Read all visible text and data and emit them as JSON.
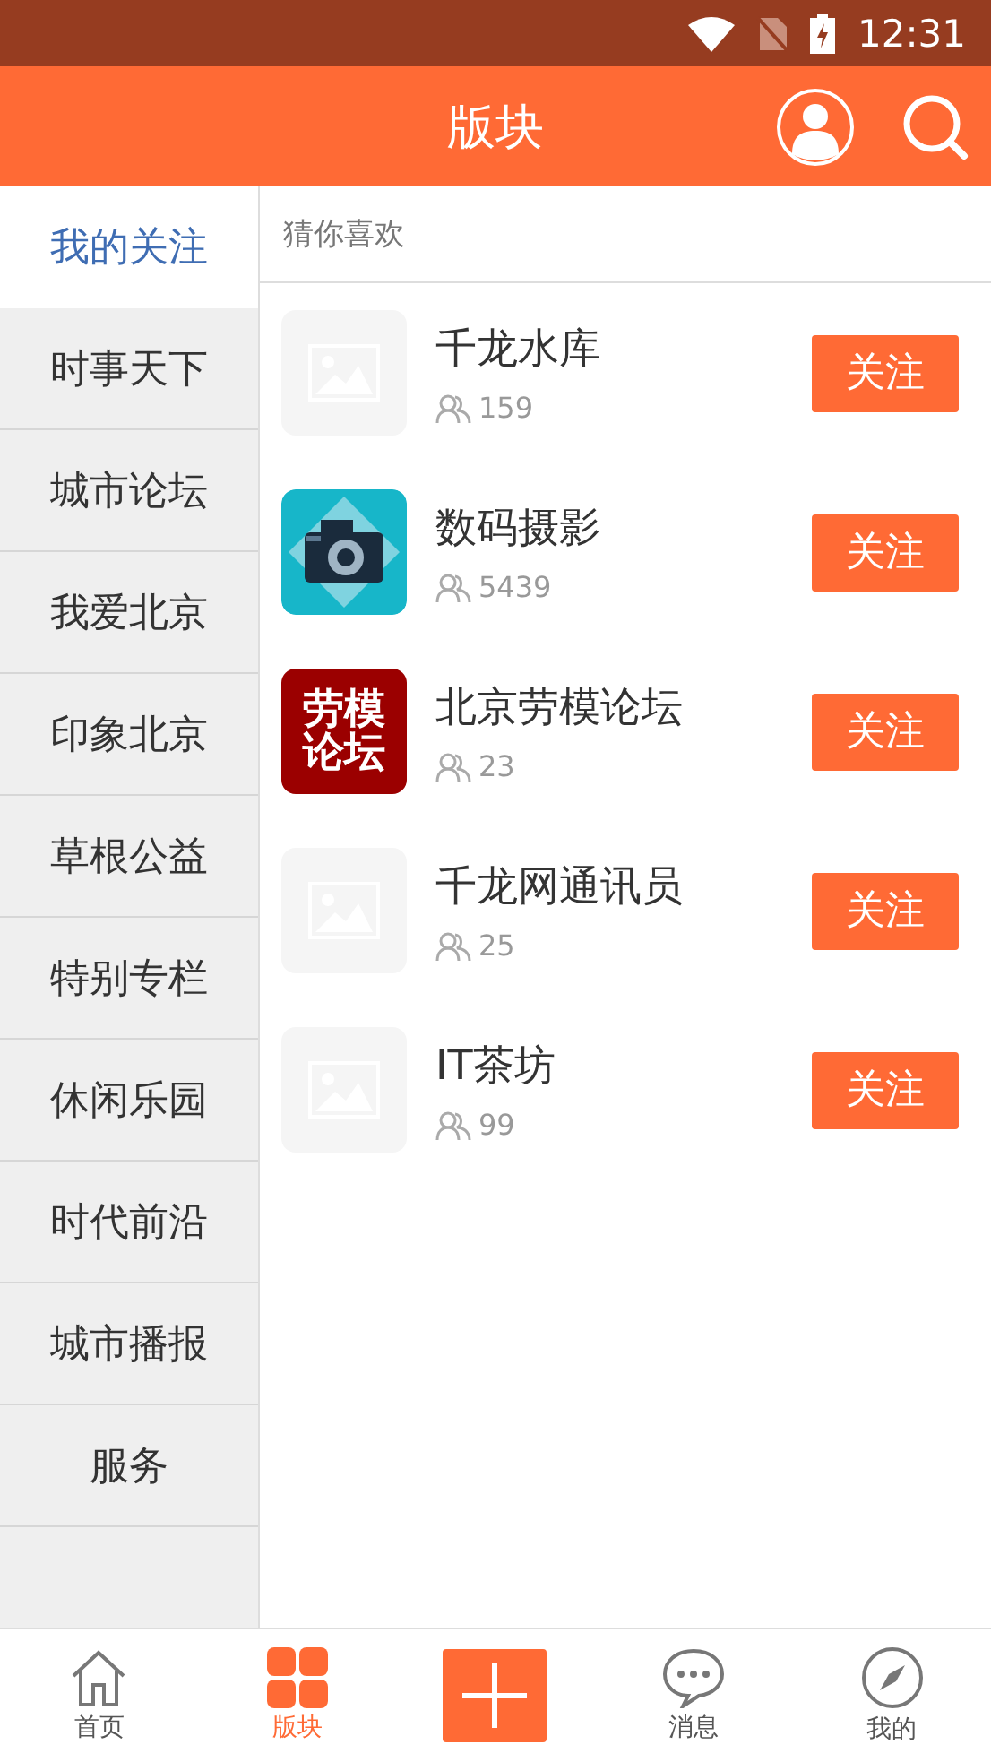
{
  "status_bar": {
    "time": "12:31"
  },
  "header": {
    "title": "版块"
  },
  "sidebar": {
    "items": [
      {
        "label": "我的关注",
        "selected": true
      },
      {
        "label": "时事天下",
        "selected": false
      },
      {
        "label": "城市论坛",
        "selected": false
      },
      {
        "label": "我爱北京",
        "selected": false
      },
      {
        "label": "印象北京",
        "selected": false
      },
      {
        "label": "草根公益",
        "selected": false
      },
      {
        "label": "特别专栏",
        "selected": false
      },
      {
        "label": "休闲乐园",
        "selected": false
      },
      {
        "label": "时代前沿",
        "selected": false
      },
      {
        "label": "城市播报",
        "selected": false
      },
      {
        "label": "服务",
        "selected": false
      }
    ]
  },
  "section_title": "猜你喜欢",
  "forums": [
    {
      "name": "千龙水库",
      "members": "159",
      "icon": {
        "kind": "placeholder"
      },
      "button": "关注"
    },
    {
      "name": "数码摄影",
      "members": "5439",
      "button": "关注"
    },
    {
      "name": "北京劳模论坛",
      "members": "23",
      "icon": {
        "kind": "logo",
        "text": "劳模论坛"
      },
      "button": "关注"
    },
    {
      "name": "千龙网通讯员",
      "members": "25",
      "icon": {
        "kind": "placeholder"
      },
      "button": "关注"
    },
    {
      "name": "IT茶坊",
      "members": "99",
      "icon": {
        "kind": "placeholder"
      },
      "button": "关注"
    }
  ],
  "bottom_nav": [
    {
      "kind": "home",
      "label": "首页",
      "selected": false
    },
    {
      "kind": "grid",
      "label": "版块",
      "selected": true
    },
    {
      "kind": "plus",
      "selected": false
    },
    {
      "kind": "chat",
      "label": "消息",
      "selected": false
    },
    {
      "kind": "compass",
      "label": "我的",
      "selected": false
    }
  ]
}
